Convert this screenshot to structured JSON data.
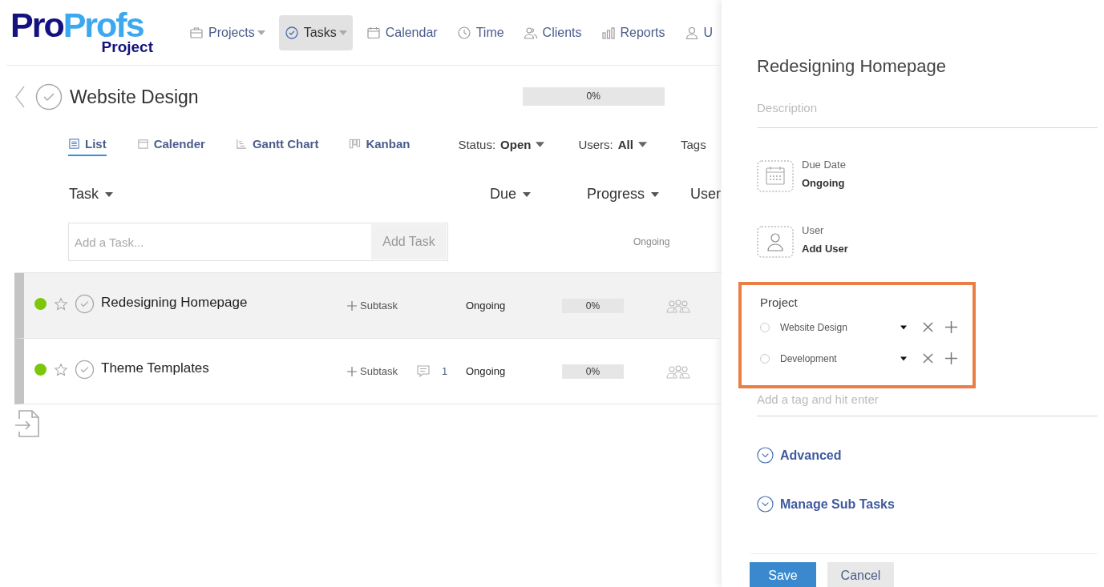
{
  "logo": {
    "part1": "Pro",
    "part2": "Profs",
    "product": "Project"
  },
  "nav": [
    {
      "label": "Projects",
      "kind": "briefcase",
      "dropdown": true,
      "selected": false
    },
    {
      "label": "Tasks",
      "kind": "check",
      "dropdown": true,
      "selected": true
    },
    {
      "label": "Calendar",
      "kind": "calendar",
      "dropdown": false,
      "selected": false
    },
    {
      "label": "Time",
      "kind": "clock",
      "dropdown": false,
      "selected": false
    },
    {
      "label": "Clients",
      "kind": "users",
      "dropdown": false,
      "selected": false
    },
    {
      "label": "Reports",
      "kind": "bars",
      "dropdown": false,
      "selected": false
    },
    {
      "label": "U",
      "kind": "user",
      "dropdown": false,
      "selected": false
    }
  ],
  "project": {
    "title": "Website Design",
    "progress": "0%",
    "level": 0
  },
  "views": [
    {
      "label": "List",
      "kind": "list",
      "selected": true
    },
    {
      "label": "Calender",
      "kind": "calendar",
      "selected": false
    },
    {
      "label": "Gantt Chart",
      "kind": "gantt",
      "selected": false
    },
    {
      "label": "Kanban",
      "kind": "kanban",
      "selected": false
    }
  ],
  "filters": [
    {
      "label": "Status:",
      "value": "Open"
    },
    {
      "label": "Users:",
      "value": "All"
    },
    {
      "label": "Tags"
    }
  ],
  "columns": [
    {
      "label": "Task",
      "caret": true
    },
    {
      "label": "Due",
      "caret": true
    },
    {
      "label": "Progress",
      "caret": true
    },
    {
      "label": "User",
      "caret": false
    }
  ],
  "add_task": {
    "placeholder": "Add a Task...",
    "button": "Add Task",
    "due": "Ongoing"
  },
  "tasks": [
    {
      "name": "Redesigning Homepage",
      "highlighted": true,
      "subtask": "Subtask",
      "due": "Ongoing",
      "progress": "0%",
      "level": 0
    },
    {
      "name": "Theme Templates",
      "highlighted": false,
      "subtask": "Subtask",
      "comments": "1",
      "due": "Ongoing",
      "progress": "0%",
      "level": 0
    }
  ],
  "panel": {
    "title": "Redesigning Homepage",
    "description_placeholder": "Description",
    "due_label": "Due Date",
    "due_value": "Ongoing",
    "user_label": "User",
    "user_value": "Add User",
    "project_label": "Project",
    "projects": [
      {
        "name": "Website Design",
        "checked": false
      },
      {
        "name": "Development",
        "checked": false
      }
    ],
    "tag_placeholder": "Add a tag and hit enter",
    "sections": [
      {
        "label": "Advanced",
        "expanded": false
      },
      {
        "label": "Manage Sub Tasks",
        "expanded": false
      }
    ],
    "save": "Save",
    "cancel": "Cancel"
  }
}
